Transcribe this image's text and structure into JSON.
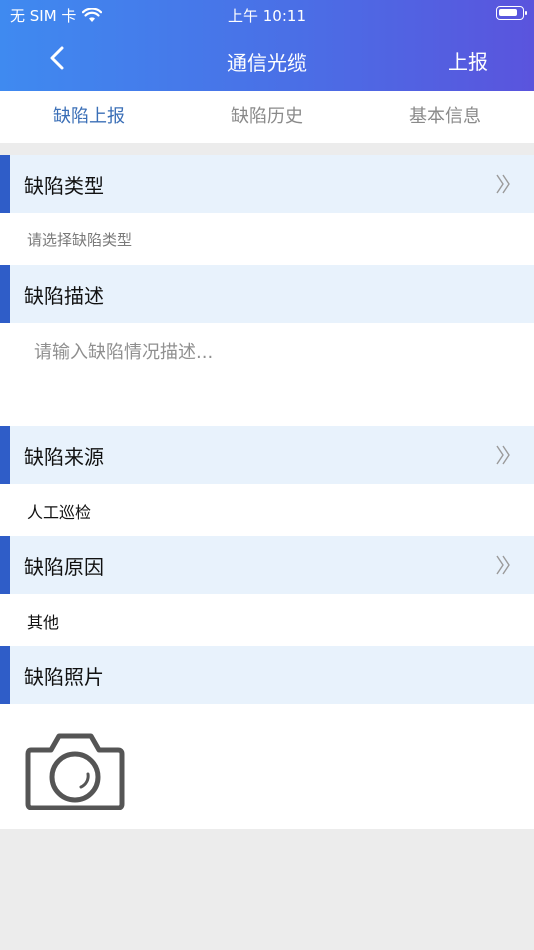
{
  "status_bar": {
    "carrier": "无 SIM 卡",
    "time": "上午 10:11"
  },
  "nav": {
    "title": "通信光缆",
    "report_label": "上报"
  },
  "tabs": [
    {
      "label": "缺陷上报"
    },
    {
      "label": "缺陷历史"
    },
    {
      "label": "基本信息"
    }
  ],
  "sections": {
    "type": {
      "label": "缺陷类型",
      "value": "请选择缺陷类型"
    },
    "description": {
      "label": "缺陷描述",
      "placeholder": "请输入缺陷情况描述..."
    },
    "source": {
      "label": "缺陷来源",
      "value": "人工巡检"
    },
    "reason": {
      "label": "缺陷原因",
      "value": "其他"
    },
    "photos": {
      "label": "缺陷照片"
    }
  },
  "colors": {
    "header_start": "#3f8af0",
    "header_end": "#5a54dd",
    "accent_bar": "#2f5dc8",
    "active_tab": "#3b6fb7",
    "section_bg": "#e8f2fc"
  },
  "icons": {
    "back": "chevron-left-icon",
    "wifi": "wifi-icon",
    "battery": "battery-icon",
    "chevron": "double-chevron-right-icon",
    "camera": "camera-icon"
  }
}
